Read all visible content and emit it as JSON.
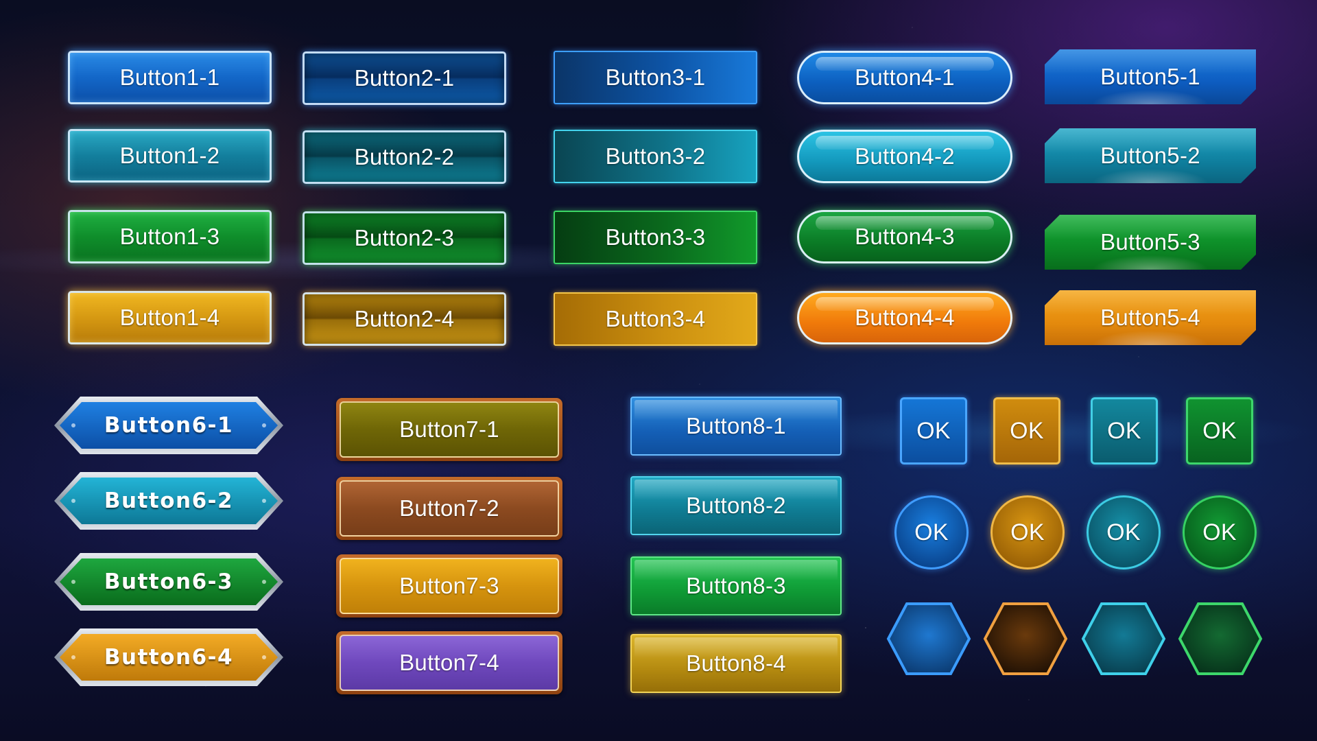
{
  "styles": {
    "style1": [
      "Button1-1",
      "Button1-2",
      "Button1-3",
      "Button1-4"
    ],
    "style2": [
      "Button2-1",
      "Button2-2",
      "Button2-3",
      "Button2-4"
    ],
    "style3": [
      "Button3-1",
      "Button3-2",
      "Button3-3",
      "Button3-4"
    ],
    "style4": [
      "Button4-1",
      "Button4-2",
      "Button4-3",
      "Button4-4"
    ],
    "style5": [
      "Button5-1",
      "Button5-2",
      "Button5-3",
      "Button5-4"
    ],
    "style6": [
      "Button6-1",
      "Button6-2",
      "Button6-3",
      "Button6-4"
    ],
    "style7": [
      "Button7-1",
      "Button7-2",
      "Button7-3",
      "Button7-4"
    ],
    "style8": [
      "Button8-1",
      "Button8-2",
      "Button8-3",
      "Button8-4"
    ]
  },
  "ok": {
    "square": [
      "OK",
      "OK",
      "OK",
      "OK"
    ],
    "circle": [
      "OK",
      "OK",
      "OK",
      "OK"
    ]
  },
  "hex_icons": [
    {
      "name": "blue",
      "fill": "#0b4f92",
      "stroke": "#3b9cff"
    },
    {
      "name": "amber",
      "fill": "#3a1e06",
      "stroke": "#f0a040"
    },
    {
      "name": "cyan",
      "fill": "#0a5468",
      "stroke": "#3fd0ea"
    },
    {
      "name": "green",
      "fill": "#0a4a20",
      "stroke": "#3dd76b"
    }
  ],
  "colors": {
    "blue": "#1367c8",
    "cyan": "#137f9d",
    "green": "#0f8e2b",
    "gold": "#d69912",
    "brown": "#8c4a20",
    "purple": "#6f48bd",
    "olive": "#6f6606"
  }
}
